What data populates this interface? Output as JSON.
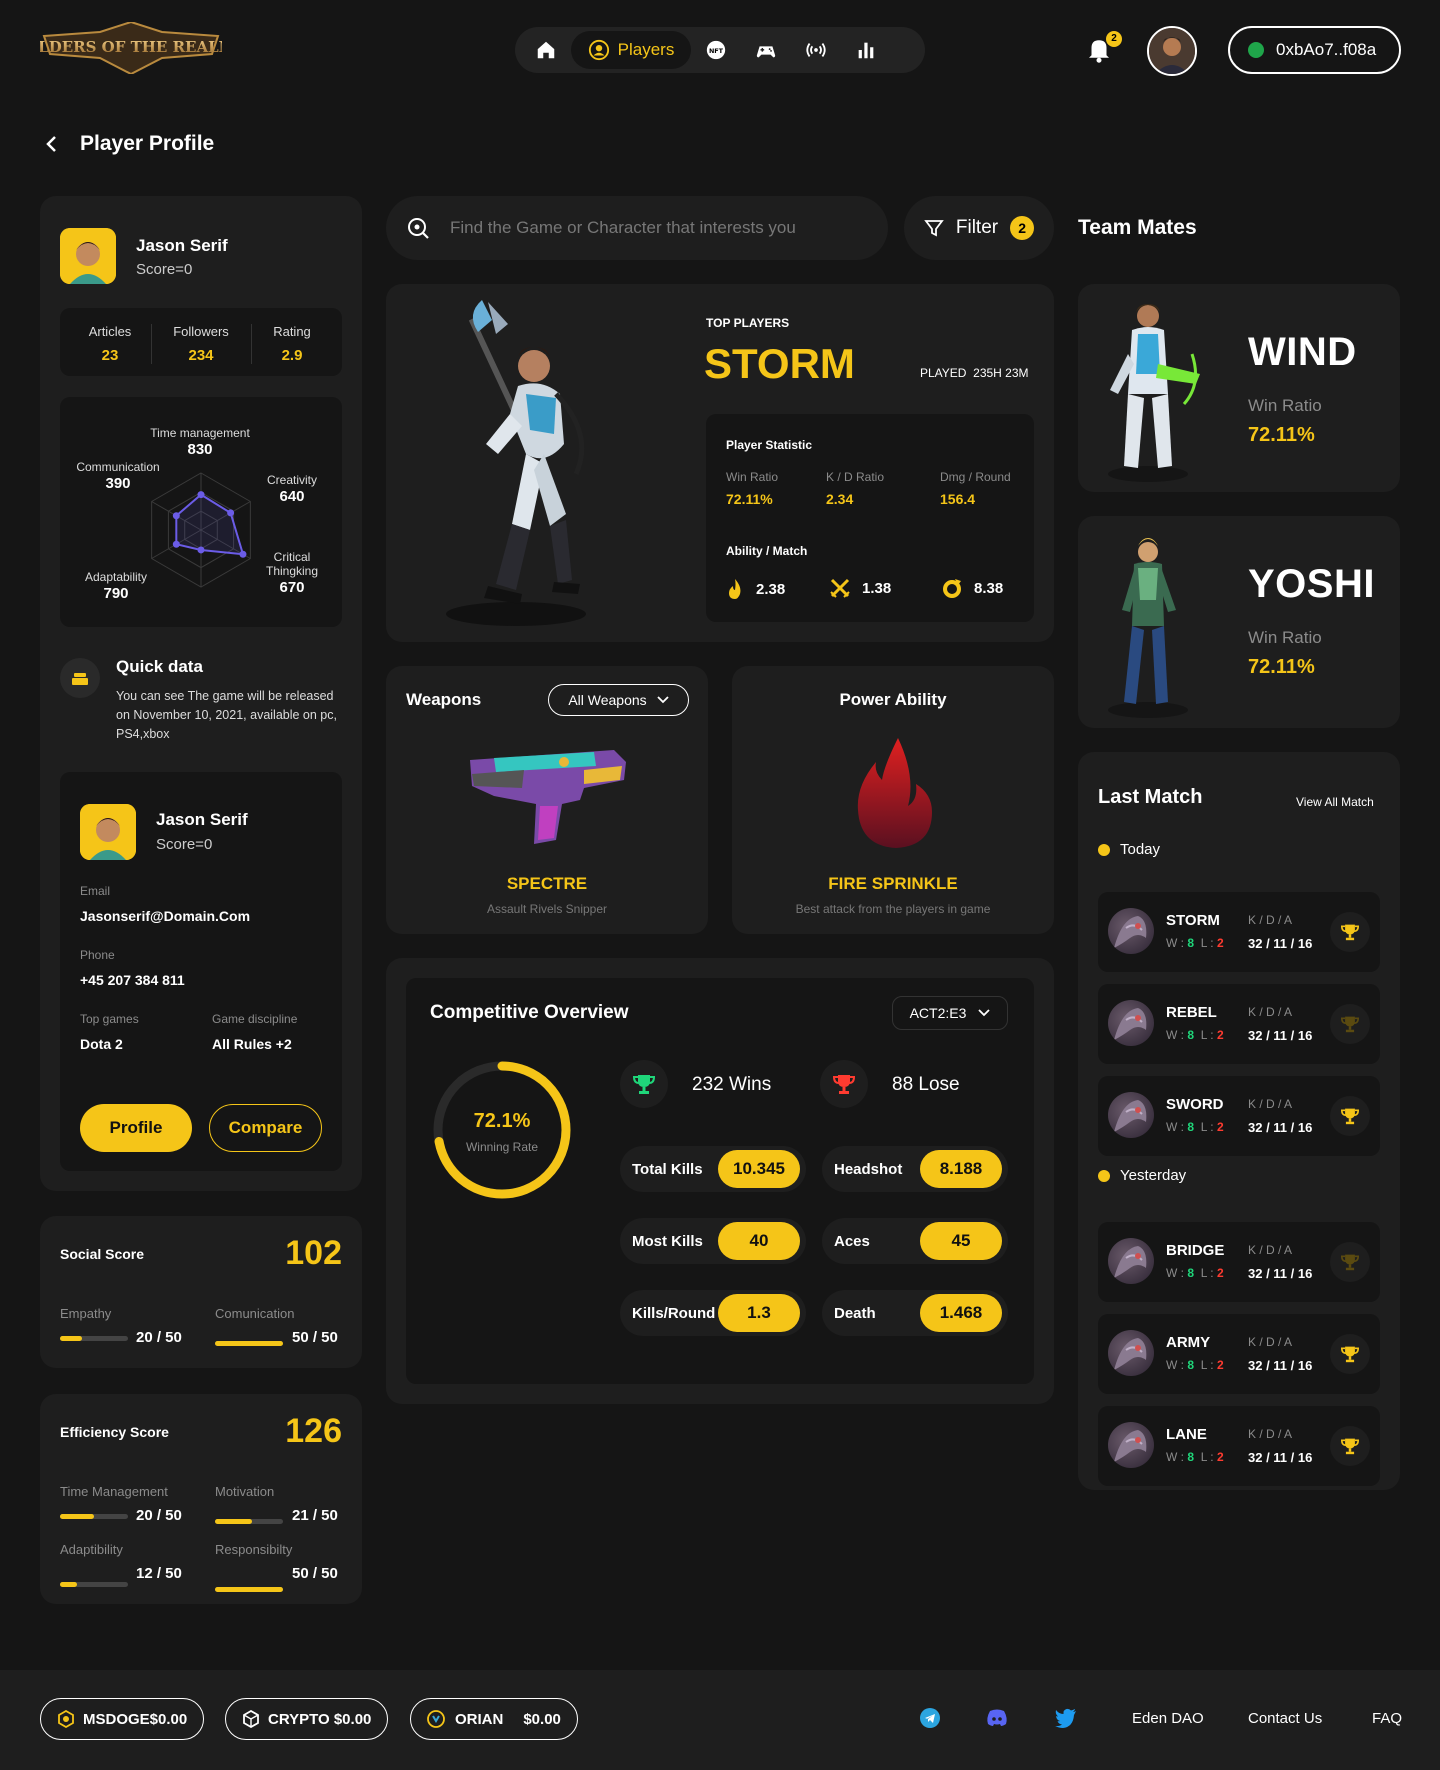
{
  "header": {
    "logo_text": "ELDERS OF THE REALM",
    "nav": [
      {
        "icon": "home-icon"
      },
      {
        "icon": "player-icon",
        "label": "Players",
        "active": true
      },
      {
        "icon": "nft-icon",
        "label": "NFT"
      },
      {
        "icon": "gamepad-icon"
      },
      {
        "icon": "broadcast-icon"
      },
      {
        "icon": "bar-chart-icon"
      }
    ],
    "notifications": "2",
    "wallet": "0xbAo7..f08a"
  },
  "page": {
    "title": "Player Profile"
  },
  "profile": {
    "name": "Jason Serif",
    "score": "Score=0",
    "stats": [
      {
        "label": "Articles",
        "value": "23"
      },
      {
        "label": "Followers",
        "value": "234"
      },
      {
        "label": "Rating",
        "value": "2.9"
      }
    ],
    "radar": [
      {
        "label": "Time management",
        "value": "830",
        "fraction": 0.62
      },
      {
        "label": "Creativity",
        "value": "640",
        "fraction": 0.6
      },
      {
        "label": "Critical Thingking",
        "value": "670",
        "fraction": 0.85
      },
      {
        "label": "",
        "value": "",
        "fraction": 0.35
      },
      {
        "label": "Adaptability",
        "value": "790",
        "fraction": 0.5
      },
      {
        "label": "Communication",
        "value": "390",
        "fraction": 0.5
      }
    ]
  },
  "quick": {
    "title": "Quick data",
    "text": "You can see The game will be released on November 10, 2021, available on pc, PS4,xbox"
  },
  "contact": {
    "name": "Jason Serif",
    "score": "Score=0",
    "email_label": "Email",
    "email": "Jasonserif@Domain.Com",
    "phone_label": "Phone",
    "phone": "+45 207 384 811",
    "topgames_label": "Top games",
    "topgames": "Dota 2",
    "discipline_label": "Game discipline",
    "discipline": "All Rules +2",
    "profile_btn": "Profile",
    "compare_btn": "Compare"
  },
  "social": {
    "title": "Social Score",
    "score": "102",
    "items": [
      {
        "label": "Empathy",
        "value": "20 / 50",
        "fraction": 0.32
      },
      {
        "label": "Comunication",
        "value": "50 / 50",
        "fraction": 1.0
      }
    ]
  },
  "efficiency": {
    "title": "Efficiency Score",
    "score": "126",
    "items": [
      {
        "label": "Time Management",
        "value": "20 / 50",
        "fraction": 0.5
      },
      {
        "label": "Motivation",
        "value": "21 / 50",
        "fraction": 0.55
      },
      {
        "label": "Adaptibility",
        "value": "12 / 50",
        "fraction": 0.25
      },
      {
        "label": "Responsibilty",
        "value": "50 / 50",
        "fraction": 1.0
      }
    ]
  },
  "search": {
    "placeholder": "Find the Game or Character that interests you"
  },
  "filter": {
    "label": "Filter",
    "count": "2"
  },
  "top": {
    "tag": "TOP PLAYERS",
    "name": "STORM",
    "played_label": "PLAYED",
    "played": "235H 23M",
    "stat_title": "Player Statistic",
    "stats": [
      {
        "label": "Win Ratio",
        "value": "72.11%"
      },
      {
        "label": "K / D Ratio",
        "value": "2.34"
      },
      {
        "label": "Dmg / Round",
        "value": "156.4"
      }
    ],
    "ability_title": "Ability / Match",
    "abilities": [
      {
        "icon": "flame-icon",
        "value": "2.38"
      },
      {
        "icon": "crossed-swords-icon",
        "value": "1.38"
      },
      {
        "icon": "ring-icon",
        "value": "8.38"
      }
    ]
  },
  "weapons": {
    "title": "Weapons",
    "select": "All Weapons",
    "name": "SPECTRE",
    "desc": "Assault Rivels Snipper"
  },
  "power": {
    "title": "Power Ability",
    "name": "FIRE SPRINKLE",
    "desc": "Best attack from the players in game"
  },
  "competitive": {
    "title": "Competitive Overview",
    "select": "ACT2:E3",
    "rate": "72.1%",
    "rate_fraction": 0.721,
    "rate_label": "Winning Rate",
    "wins": "232 Wins",
    "lose": "88 Lose",
    "pills": [
      {
        "label": "Total Kills",
        "value": "10.345"
      },
      {
        "label": "Headshot",
        "value": "8.188"
      },
      {
        "label": "Most Kills",
        "value": "40"
      },
      {
        "label": "Aces",
        "value": "45"
      },
      {
        "label": "Kills/Round",
        "value": "1.3"
      },
      {
        "label": "Death",
        "value": "1.468"
      }
    ]
  },
  "teammates": {
    "title": "Team Mates",
    "winratio_label": "Win Ratio",
    "mates": [
      {
        "name": "WIND",
        "ratio": "72.11%"
      },
      {
        "name": "YOSHI",
        "ratio": "72.11%"
      }
    ]
  },
  "lastmatch": {
    "title": "Last Match",
    "view_all": "View All Match",
    "today": "Today",
    "yesterday": "Yesterday",
    "kda_label": "K / D / A",
    "w_label": "W :",
    "l_label": "L :",
    "matches": [
      {
        "name": "STORM",
        "w": "8",
        "l": "2",
        "kda": "32 / 11 / 16",
        "won": true
      },
      {
        "name": "REBEL",
        "w": "8",
        "l": "2",
        "kda": "32 / 11 / 16",
        "won": false
      },
      {
        "name": "SWORD",
        "w": "8",
        "l": "2",
        "kda": "32 / 11 / 16",
        "won": true
      },
      {
        "name": "BRIDGE",
        "w": "8",
        "l": "2",
        "kda": "32 / 11 / 16",
        "won": false
      },
      {
        "name": "ARMY",
        "w": "8",
        "l": "2",
        "kda": "32 / 11 / 16",
        "won": true
      },
      {
        "name": "LANE",
        "w": "8",
        "l": "2",
        "kda": "32 / 11 / 16",
        "won": true
      }
    ]
  },
  "footer": {
    "coins": [
      {
        "label": "MSDOGE$0.00",
        "icon": "msdoge-icon"
      },
      {
        "label": "CRYPTO $0.00",
        "icon": "crypto-icon"
      },
      {
        "label": "ORIAN",
        "value": "$0.00",
        "icon": "orian-icon"
      }
    ],
    "social_icons": [
      "telegram-icon",
      "discord-icon",
      "twitter-icon"
    ],
    "links": [
      "Eden DAO",
      "Contact Us",
      "FAQ"
    ]
  },
  "colors": {
    "accent": "#f5c518",
    "bg": "#151515",
    "card": "#1e1e1e",
    "win": "#1fd67a",
    "loss": "#ff3b30"
  }
}
